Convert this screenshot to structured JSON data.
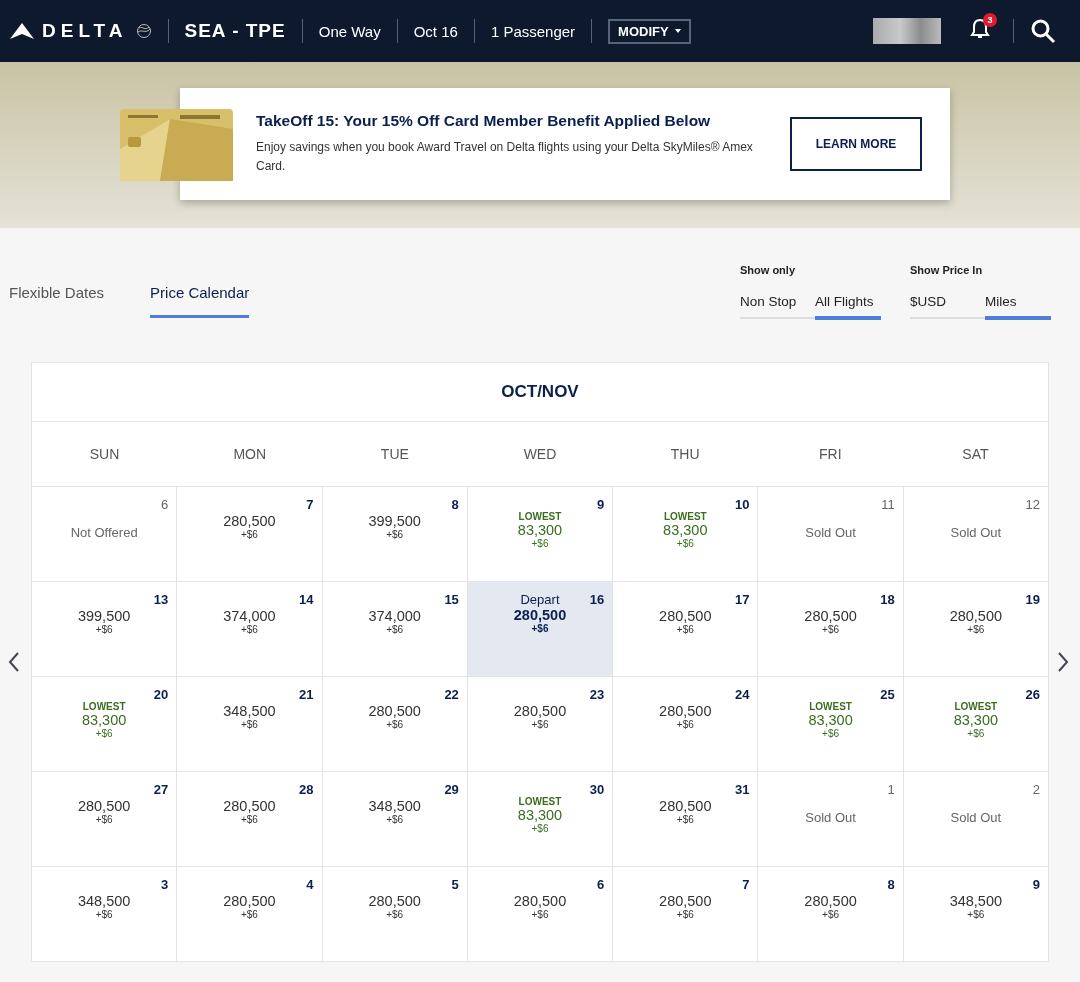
{
  "header": {
    "logo": "DELTA",
    "route": "SEA - TPE",
    "trip": "One Way",
    "date": "Oct 16",
    "passengers": "1 Passenger",
    "modify": "MODIFY",
    "notifications": "3"
  },
  "promo": {
    "title": "TakeOff 15: Your 15% Off Card Member Benefit Applied Below",
    "text": "Enjoy savings when you book Award Travel on Delta flights using your Delta SkyMiles® Amex Card.",
    "button": "LEARN MORE"
  },
  "tabs": [
    {
      "label": "Flexible Dates",
      "selected": false
    },
    {
      "label": "Price Calendar",
      "selected": true
    }
  ],
  "filters": [
    {
      "label": "Show only",
      "options": [
        {
          "label": "Non Stop",
          "selected": false
        },
        {
          "label": "All Flights",
          "selected": true
        }
      ]
    },
    {
      "label": "Show Price In",
      "options": [
        {
          "label": "$USD",
          "selected": false
        },
        {
          "label": "Miles",
          "selected": true
        }
      ]
    }
  ],
  "calendar": {
    "title": "OCT/NOV",
    "weekdays": [
      "SUN",
      "MON",
      "TUE",
      "WED",
      "THU",
      "FRI",
      "SAT"
    ],
    "weeks": [
      [
        {
          "day": "6",
          "kind": "unavailable",
          "label": "Not Offered",
          "selected": false
        },
        {
          "day": "7",
          "kind": "price",
          "price": "280,500",
          "fee": "+$6",
          "selected": false
        },
        {
          "day": "8",
          "kind": "price",
          "price": "399,500",
          "fee": "+$6",
          "selected": false
        },
        {
          "day": "9",
          "kind": "lowest",
          "label": "LOWEST",
          "price": "83,300",
          "fee": "+$6",
          "selected": false
        },
        {
          "day": "10",
          "kind": "lowest",
          "label": "LOWEST",
          "price": "83,300",
          "fee": "+$6",
          "selected": false
        },
        {
          "day": "11",
          "kind": "unavailable",
          "label": "Sold Out",
          "selected": false
        },
        {
          "day": "12",
          "kind": "unavailable",
          "label": "Sold Out",
          "selected": false
        }
      ],
      [
        {
          "day": "13",
          "kind": "price",
          "price": "399,500",
          "fee": "+$6",
          "selected": false
        },
        {
          "day": "14",
          "kind": "price",
          "price": "374,000",
          "fee": "+$6",
          "selected": false
        },
        {
          "day": "15",
          "kind": "price",
          "price": "374,000",
          "fee": "+$6",
          "selected": false
        },
        {
          "day": "16",
          "kind": "depart",
          "label": "Depart",
          "price": "280,500",
          "fee": "+$6",
          "selected": true
        },
        {
          "day": "17",
          "kind": "price",
          "price": "280,500",
          "fee": "+$6",
          "selected": false
        },
        {
          "day": "18",
          "kind": "price",
          "price": "280,500",
          "fee": "+$6",
          "selected": false
        },
        {
          "day": "19",
          "kind": "price",
          "price": "280,500",
          "fee": "+$6",
          "selected": false
        }
      ],
      [
        {
          "day": "20",
          "kind": "lowest",
          "label": "LOWEST",
          "price": "83,300",
          "fee": "+$6",
          "selected": false
        },
        {
          "day": "21",
          "kind": "price",
          "price": "348,500",
          "fee": "+$6",
          "selected": false
        },
        {
          "day": "22",
          "kind": "price",
          "price": "280,500",
          "fee": "+$6",
          "selected": false
        },
        {
          "day": "23",
          "kind": "price",
          "price": "280,500",
          "fee": "+$6",
          "selected": false
        },
        {
          "day": "24",
          "kind": "price",
          "price": "280,500",
          "fee": "+$6",
          "selected": false
        },
        {
          "day": "25",
          "kind": "lowest",
          "label": "LOWEST",
          "price": "83,300",
          "fee": "+$6",
          "selected": false
        },
        {
          "day": "26",
          "kind": "lowest",
          "label": "LOWEST",
          "price": "83,300",
          "fee": "+$6",
          "selected": false
        }
      ],
      [
        {
          "day": "27",
          "kind": "price",
          "price": "280,500",
          "fee": "+$6",
          "selected": false
        },
        {
          "day": "28",
          "kind": "price",
          "price": "280,500",
          "fee": "+$6",
          "selected": false
        },
        {
          "day": "29",
          "kind": "price",
          "price": "348,500",
          "fee": "+$6",
          "selected": false
        },
        {
          "day": "30",
          "kind": "lowest",
          "label": "LOWEST",
          "price": "83,300",
          "fee": "+$6",
          "selected": false
        },
        {
          "day": "31",
          "kind": "price",
          "price": "280,500",
          "fee": "+$6",
          "selected": false
        },
        {
          "day": "1",
          "kind": "unavailable",
          "label": "Sold Out",
          "selected": false
        },
        {
          "day": "2",
          "kind": "unavailable",
          "label": "Sold Out",
          "selected": false
        }
      ],
      [
        {
          "day": "3",
          "kind": "price",
          "price": "348,500",
          "fee": "+$6",
          "selected": false
        },
        {
          "day": "4",
          "kind": "price",
          "price": "280,500",
          "fee": "+$6",
          "selected": false
        },
        {
          "day": "5",
          "kind": "price",
          "price": "280,500",
          "fee": "+$6",
          "selected": false
        },
        {
          "day": "6",
          "kind": "price",
          "price": "280,500",
          "fee": "+$6",
          "selected": false
        },
        {
          "day": "7",
          "kind": "price",
          "price": "280,500",
          "fee": "+$6",
          "selected": false
        },
        {
          "day": "8",
          "kind": "price",
          "price": "280,500",
          "fee": "+$6",
          "selected": false
        },
        {
          "day": "9",
          "kind": "price",
          "price": "348,500",
          "fee": "+$6",
          "selected": false
        }
      ]
    ]
  }
}
